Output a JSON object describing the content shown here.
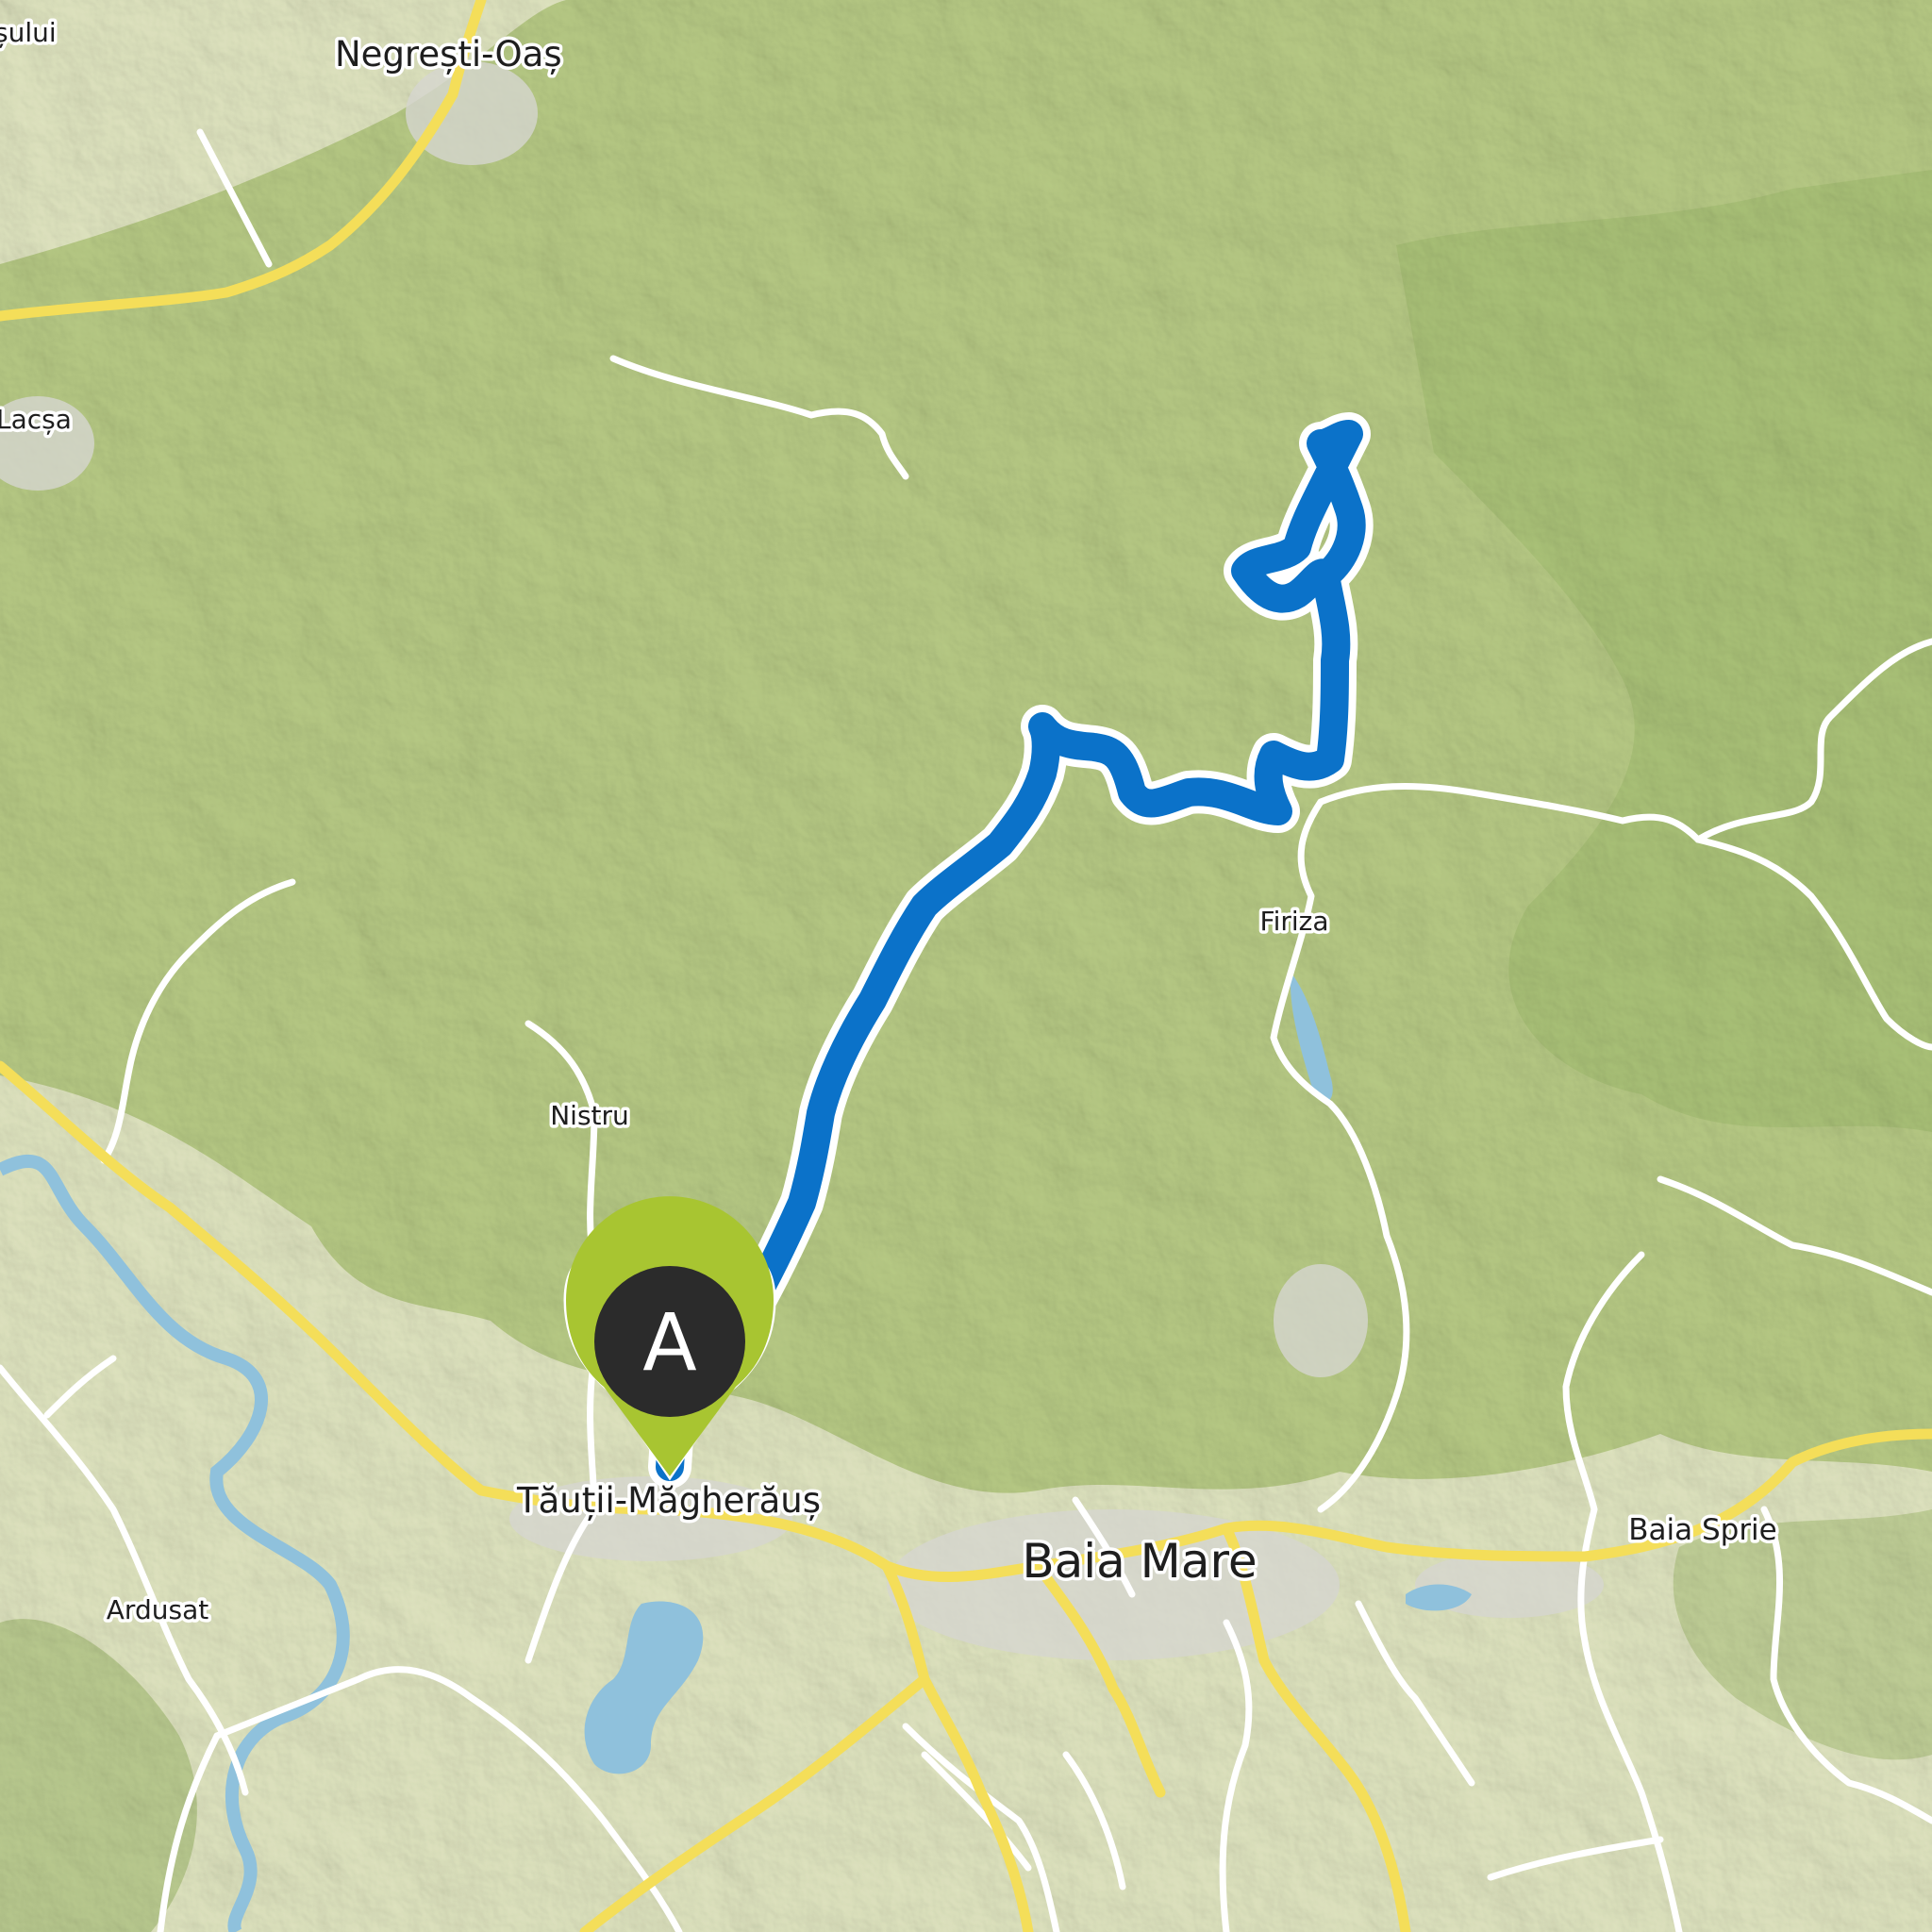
{
  "map": {
    "places": [
      {
        "id": "negresti-oas",
        "name": "Negrești-Oaș"
      },
      {
        "id": "sului",
        "name": "șului"
      },
      {
        "id": "lacsa",
        "name": "Lacșa"
      },
      {
        "id": "firiza",
        "name": "Firiza"
      },
      {
        "id": "nistru",
        "name": "Nistru"
      },
      {
        "id": "tautii-magheraus",
        "name": "Tăuții-Măgherăuș"
      },
      {
        "id": "baia-mare",
        "name": "Baia Mare"
      },
      {
        "id": "baia-sprie",
        "name": "Baia Sprie"
      },
      {
        "id": "ardusat",
        "name": "Ardusat"
      }
    ],
    "route": {
      "color": "#0b72c9",
      "outline_color": "#ffffff"
    },
    "start_marker": {
      "label": "A",
      "pin_color": "#a8c531",
      "disc_color": "#2b2b2b"
    },
    "colors": {
      "lowland": "#e2e7c2",
      "hills": "#b9cc86",
      "forest": "#a3bd70",
      "water": "#8fc1dc",
      "main_road": "#f4de59",
      "minor_road": "#ffffff",
      "built_up": "#d6d6d0"
    }
  }
}
